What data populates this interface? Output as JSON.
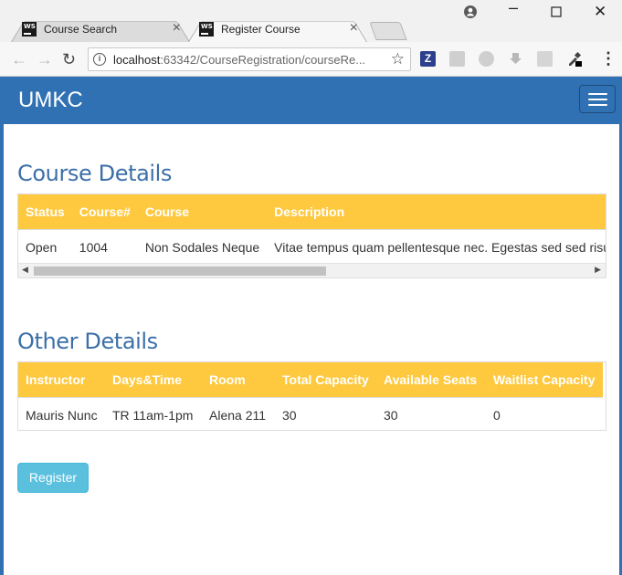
{
  "browser": {
    "tabs": [
      {
        "label": "Course Search",
        "icon": "WS"
      },
      {
        "label": "Register Course",
        "icon": "WS"
      }
    ],
    "url_host": "localhost",
    "url_rest": ":63342/CourseRegistration/courseRe..."
  },
  "navbar": {
    "brand": "UMKC"
  },
  "course_details": {
    "title": "Course Details",
    "headers": [
      "Status",
      "Course#",
      "Course",
      "Description"
    ],
    "row": [
      "Open",
      "1004",
      "Non Sodales Neque",
      "Vitae tempus quam pellentesque nec. Egestas sed sed risus"
    ]
  },
  "other_details": {
    "title": "Other Details",
    "headers": [
      "Instructor",
      "Days&Time",
      "Room",
      "Total Capacity",
      "Available Seats",
      "Waitlist Capacity"
    ],
    "row": [
      "Mauris Nunc",
      "TR 11am-1pm",
      "Alena 211",
      "30",
      "30",
      "0"
    ]
  },
  "register_label": "Register",
  "colors": {
    "navbar": "#2f71b3",
    "table_header": "#fec93f",
    "button": "#5bc0de",
    "heading": "#3c6fa8"
  }
}
